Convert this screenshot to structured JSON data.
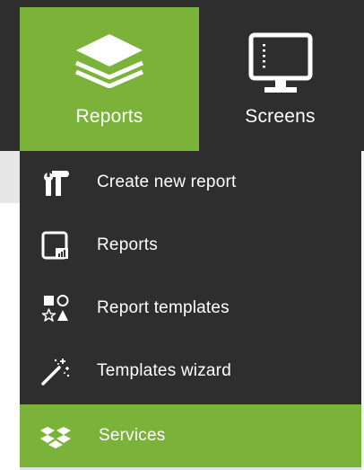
{
  "nav": {
    "tiles": [
      {
        "label": "Reports",
        "icon": "stack-layers-icon",
        "active": true
      },
      {
        "label": "Screens",
        "icon": "monitor-icon",
        "active": false
      }
    ]
  },
  "menu": {
    "items": [
      {
        "label": "Create new report",
        "icon": "hammer-wrench-icon"
      },
      {
        "label": "Reports",
        "icon": "report-chart-icon"
      },
      {
        "label": "Report templates",
        "icon": "shapes-icon"
      },
      {
        "label": "Templates wizard",
        "icon": "magic-wand-icon"
      },
      {
        "label": "Services",
        "icon": "dropbox-box-icon",
        "active": true
      }
    ]
  },
  "colors": {
    "accent": "#7bb23a",
    "dark": "#2e2e2e",
    "text": "#ffffff"
  }
}
